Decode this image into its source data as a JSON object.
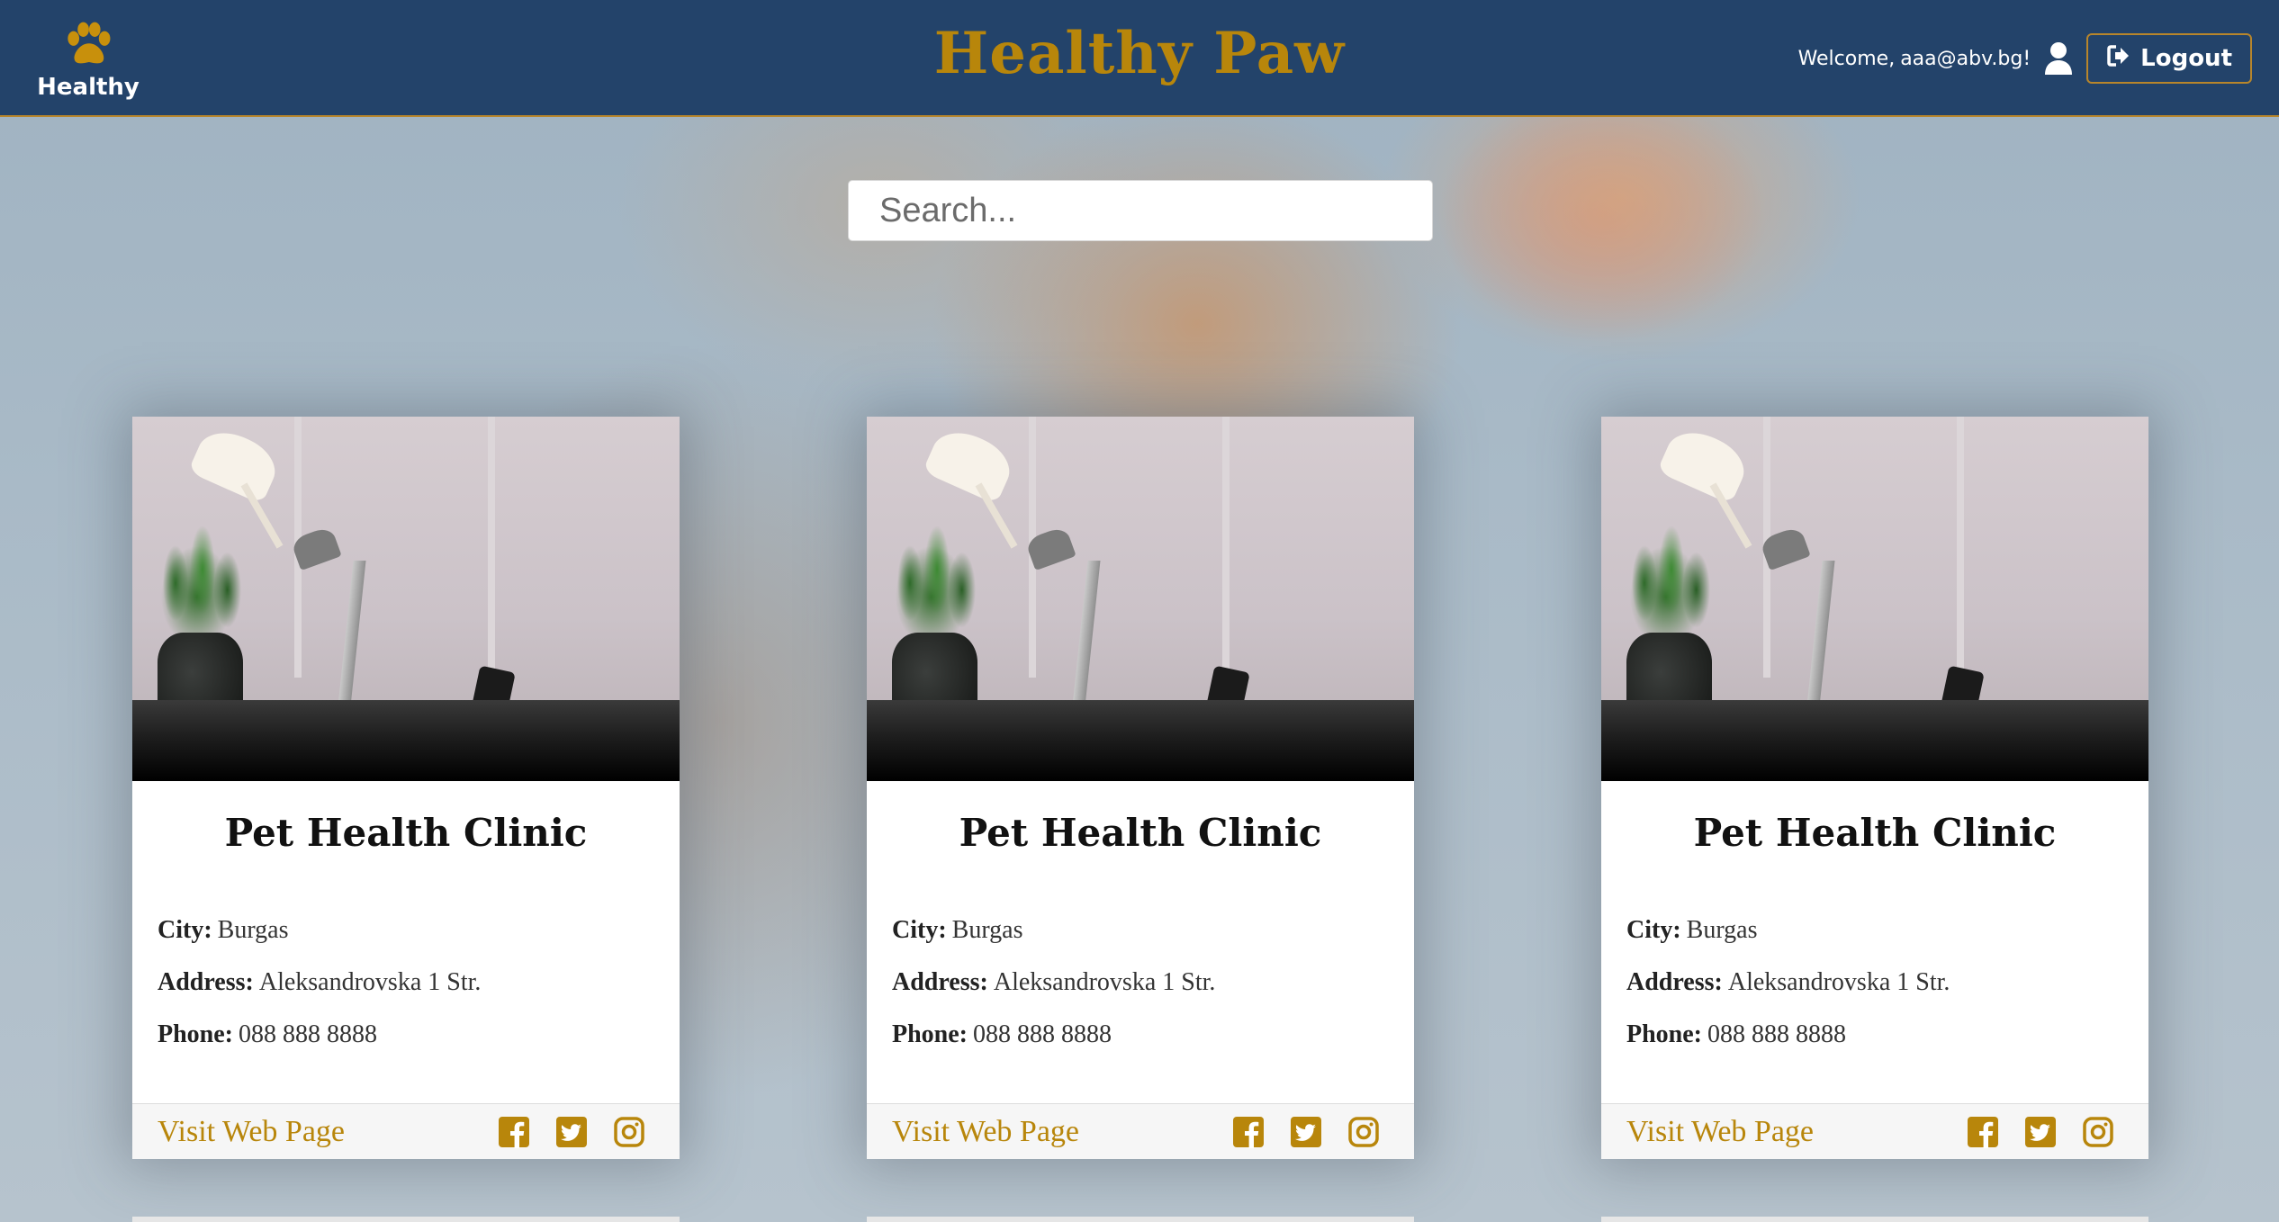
{
  "header": {
    "brand_text": "Healthy",
    "brand_icon": "paw-icon",
    "title": "Healthy Paw",
    "welcome_prefix": "Welcome,",
    "welcome_user": "aaa@abv.bg!",
    "user_icon": "user-icon",
    "logout_label": "Logout",
    "logout_icon": "sign-out-icon"
  },
  "search": {
    "placeholder": "Search..."
  },
  "colors": {
    "navbar": "#23436a",
    "accent": "#b8860b",
    "card_bg": "#ffffff"
  },
  "cards": [
    {
      "title": "Pet Health Clinic",
      "city_label": "City:",
      "city": "Burgas",
      "address_label": "Address:",
      "address": "Aleksandrovska 1 Str.",
      "phone_label": "Phone:",
      "phone": "088 888 8888",
      "link_label": "Visit Web Page",
      "social_icons": [
        "facebook-icon",
        "twitter-icon",
        "instagram-icon"
      ]
    },
    {
      "title": "Pet Health Clinic",
      "city_label": "City:",
      "city": "Burgas",
      "address_label": "Address:",
      "address": "Aleksandrovska 1 Str.",
      "phone_label": "Phone:",
      "phone": "088 888 8888",
      "link_label": "Visit Web Page",
      "social_icons": [
        "facebook-icon",
        "twitter-icon",
        "instagram-icon"
      ]
    },
    {
      "title": "Pet Health Clinic",
      "city_label": "City:",
      "city": "Burgas",
      "address_label": "Address:",
      "address": "Aleksandrovska 1 Str.",
      "phone_label": "Phone:",
      "phone": "088 888 8888",
      "link_label": "Visit Web Page",
      "social_icons": [
        "facebook-icon",
        "twitter-icon",
        "instagram-icon"
      ]
    }
  ]
}
